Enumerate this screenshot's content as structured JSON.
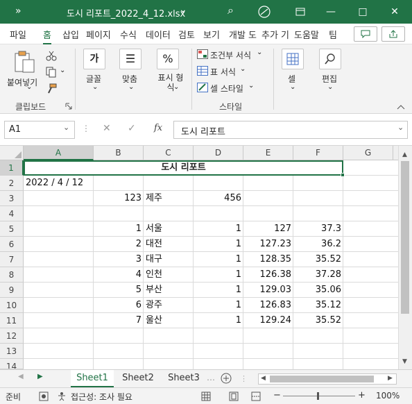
{
  "titlebar": {
    "qa_overflow": "»",
    "title": "도시 리포트_2022_4_12.xlsx",
    "dropdown": "⌄",
    "search_icon": "⌕",
    "minimize": "—",
    "restore": "□",
    "close": "✕"
  },
  "tabs": [
    "파일",
    "홈",
    "삽입",
    "페이지",
    "수식",
    "데이터",
    "검토",
    "보기",
    "개발 도",
    "추가 기",
    "도움말",
    "팀"
  ],
  "active_tab": "홈",
  "ribbon": {
    "paste_label": "붙여넣기",
    "clipboard_label": "클립보드",
    "font_label": "글꼴",
    "align_label": "맞춤",
    "number_label": "표시 형식",
    "cond_format": "조건부 서식",
    "table_format": "표 서식",
    "cell_styles": "셀 스타일",
    "styles_label": "스타일",
    "cells_label": "셀",
    "edit_label": "편집",
    "font_glyph": "가",
    "align_glyph": "☰",
    "percent_glyph": "%",
    "chev": "⌄"
  },
  "formula_bar": {
    "name_box": "A1",
    "fx": "fx",
    "content": "도시 리포트"
  },
  "columns": [
    "A",
    "B",
    "C",
    "D",
    "E",
    "F",
    "G"
  ],
  "rows": [
    1,
    2,
    3,
    4,
    5,
    6,
    7,
    8,
    9,
    10,
    11,
    12,
    13,
    14
  ],
  "cells": {
    "title": "도시 리포트",
    "date": "2022 / 4 / 12",
    "r3": {
      "b": "123",
      "c": "제주",
      "d": "456"
    },
    "data_rows": [
      {
        "b": "1",
        "c": "서울",
        "d": "1",
        "e": "127",
        "f": "37.3"
      },
      {
        "b": "2",
        "c": "대전",
        "d": "1",
        "e": "127.23",
        "f": "36.2"
      },
      {
        "b": "3",
        "c": "대구",
        "d": "1",
        "e": "128.35",
        "f": "35.52"
      },
      {
        "b": "4",
        "c": "인천",
        "d": "1",
        "e": "126.38",
        "f": "37.28"
      },
      {
        "b": "5",
        "c": "부산",
        "d": "1",
        "e": "129.03",
        "f": "35.06"
      },
      {
        "b": "6",
        "c": "광주",
        "d": "1",
        "e": "126.83",
        "f": "35.12"
      },
      {
        "b": "7",
        "c": "울산",
        "d": "1",
        "e": "129.24",
        "f": "35.52"
      }
    ]
  },
  "sheets": [
    "Sheet1",
    "Sheet2",
    "Sheet3"
  ],
  "active_sheet": "Sheet1",
  "statusbar": {
    "ready": "준비",
    "accessibility": "접근성: 조사 필요",
    "zoom": "100%"
  },
  "accent_color": "#217346"
}
